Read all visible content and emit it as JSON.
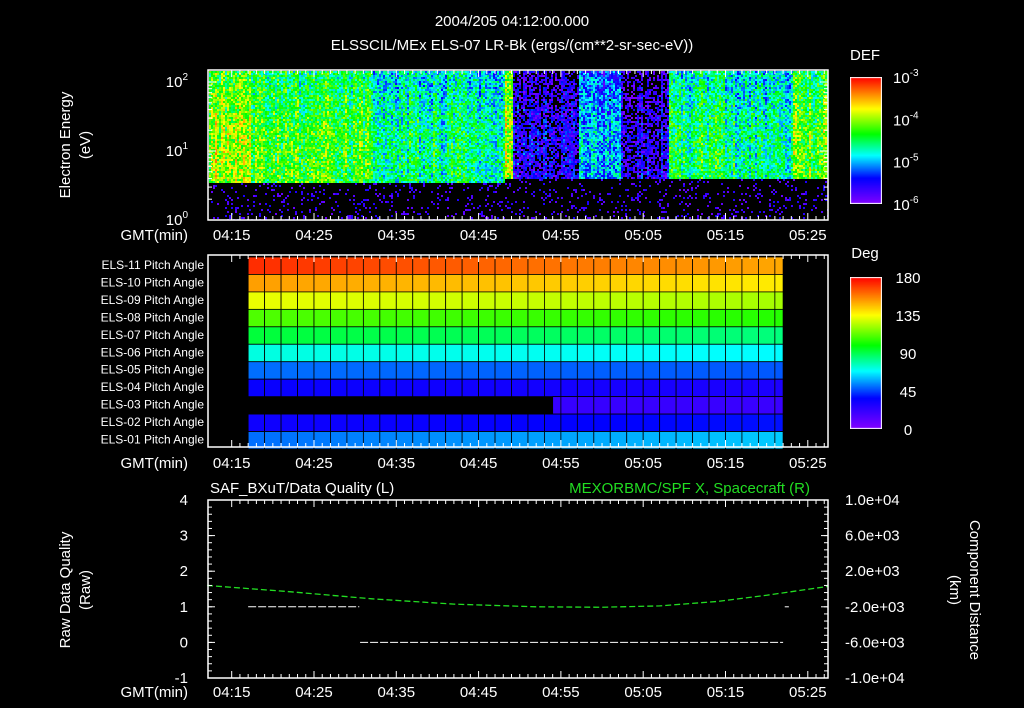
{
  "header": {
    "title": "2004/205 04:12:00.000",
    "subtitle": "ELSSCIL/MEx ELS-07 LR-Bk  (ergs/(cm**2-sr-sec-eV))"
  },
  "time_axis": {
    "label": "GMT(min)",
    "ticks": [
      "04:15",
      "04:25",
      "04:35",
      "04:45",
      "04:55",
      "05:05",
      "05:15",
      "05:25"
    ],
    "start": "04:12",
    "end": "05:27.5"
  },
  "chart_data": [
    {
      "type": "heatmap",
      "name": "spectrogram",
      "ylabel": "Electron Energy",
      "yunit": "(eV)",
      "yscale": "log",
      "ylim": [
        1,
        150
      ],
      "ytick_labels": [
        "10^0",
        "10^1",
        "10^2"
      ],
      "colorbar": {
        "title": "DEF",
        "scale": "log",
        "range": [
          1e-06,
          0.001
        ],
        "tick_labels": [
          "10^-3",
          "10^-4",
          "10^-5",
          "10^-6"
        ]
      },
      "segments": [
        {
          "start": 0,
          "end": 5,
          "log_def": -4.0,
          "low_cutoff_ev": 3.5
        },
        {
          "start": 5,
          "end": 20,
          "log_def": -4.3,
          "low_cutoff_ev": 3.5
        },
        {
          "start": 20,
          "end": 36,
          "log_def": -4.6,
          "low_cutoff_ev": 3.5
        },
        {
          "start": 36,
          "end": 37,
          "log_def": -4.0,
          "low_cutoff_ev": 4
        },
        {
          "start": 37,
          "end": 45,
          "log_def": -5.6,
          "low_cutoff_ev": 4
        },
        {
          "start": 45,
          "end": 50,
          "log_def": -5.0,
          "low_cutoff_ev": 4
        },
        {
          "start": 50,
          "end": 56,
          "log_def": -5.7,
          "low_cutoff_ev": 4
        },
        {
          "start": 56,
          "end": 64,
          "log_def": -4.5,
          "low_cutoff_ev": 4
        },
        {
          "start": 64,
          "end": 71,
          "log_def": -4.7,
          "low_cutoff_ev": 4
        },
        {
          "start": 71,
          "end": 75.5,
          "log_def": -4.2,
          "low_cutoff_ev": 4
        }
      ]
    },
    {
      "type": "heatmap",
      "name": "pitch-angle",
      "rows": [
        {
          "label": "ELS-11 Pitch Angle",
          "start_deg": 172,
          "end_deg": 150
        },
        {
          "label": "ELS-10 Pitch Angle",
          "start_deg": 152,
          "end_deg": 138
        },
        {
          "label": "ELS-09 Pitch Angle",
          "start_deg": 132,
          "end_deg": 122
        },
        {
          "label": "ELS-08 Pitch Angle",
          "start_deg": 110,
          "end_deg": 104
        },
        {
          "label": "ELS-07 Pitch Angle",
          "start_deg": 92,
          "end_deg": 84
        },
        {
          "label": "ELS-06 Pitch Angle",
          "start_deg": 72,
          "end_deg": 68
        },
        {
          "label": "ELS-05 Pitch Angle",
          "start_deg": 50,
          "end_deg": 47
        },
        {
          "label": "ELS-04 Pitch Angle",
          "start_deg": 34,
          "end_deg": 28
        },
        {
          "label": "ELS-03 Pitch Angle",
          "start_deg": 22,
          "end_deg": 20,
          "data_from_min": 42
        },
        {
          "label": "ELS-02 Pitch Angle",
          "start_deg": 32,
          "end_deg": 38
        },
        {
          "label": "ELS-01 Pitch Angle",
          "start_deg": 50,
          "end_deg": 62
        }
      ],
      "data_range_min": [
        5,
        70
      ],
      "colorbar": {
        "title": "Deg",
        "range": [
          0,
          180
        ],
        "tick_labels": [
          "180",
          "135",
          "90",
          "45",
          "0"
        ]
      }
    },
    {
      "type": "line",
      "name": "data-quality",
      "left_title": "SAF_BXuT/Data Quality (L)",
      "right_title": "MEXORBMC/SPF X, Spacecraft (R)",
      "ylabel": "Raw Data Quality",
      "yunit": "(Raw)",
      "ylim": [
        -1,
        4
      ],
      "ytick_labels": [
        "4",
        "3",
        "2",
        "1",
        "0",
        "-1"
      ],
      "y2label": "Component Distance",
      "y2unit": "(km)",
      "y2lim": [
        -10000,
        10000
      ],
      "y2tick_labels": [
        "1.0e+04",
        "6.0e+03",
        "2.0e+03",
        "-2.0e+03",
        "-6.0e+03",
        "-1.0e+04"
      ],
      "series": [
        {
          "name": "Data Quality",
          "color": "#ffffff",
          "points_min": [
            [
              5,
              1
            ],
            [
              18.5,
              1
            ],
            [
              18.6,
              0
            ],
            [
              70,
              0
            ],
            [
              70.2,
              1
            ],
            [
              70.7,
              1
            ]
          ]
        },
        {
          "name": "Spacecraft X",
          "color": "#22dd22",
          "points_min": [
            [
              0,
              400
            ],
            [
              10,
              -300
            ],
            [
              20,
              -1100
            ],
            [
              30,
              -1700
            ],
            [
              40,
              -2000
            ],
            [
              48,
              -2050
            ],
            [
              55,
              -1900
            ],
            [
              62,
              -1400
            ],
            [
              68,
              -700
            ],
            [
              75.5,
              300
            ]
          ]
        }
      ]
    }
  ]
}
